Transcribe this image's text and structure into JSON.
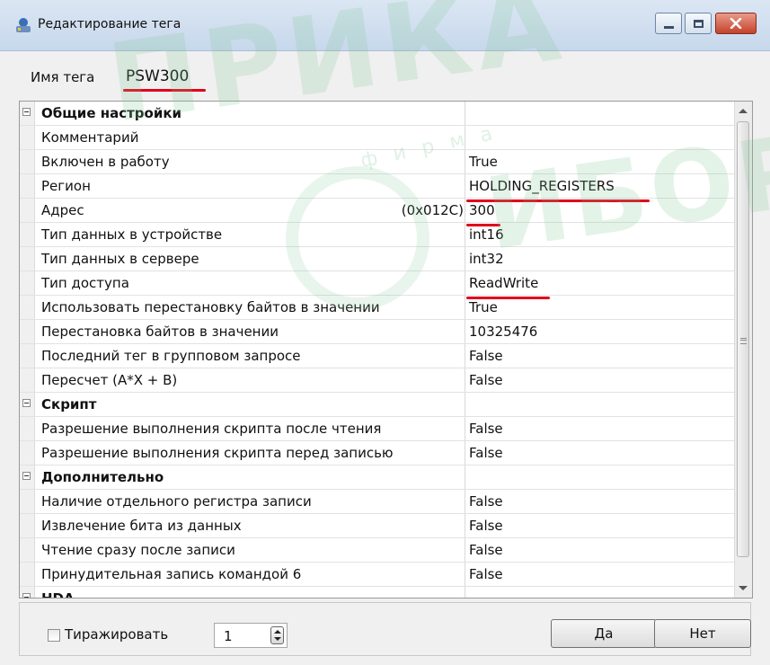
{
  "window": {
    "title": "Редактирование тега"
  },
  "tag": {
    "label": "Имя тега",
    "value": "PSW300"
  },
  "properties": [
    {
      "type": "category",
      "label": "Общие настройки"
    },
    {
      "type": "prop",
      "label": "Комментарий",
      "value": ""
    },
    {
      "type": "prop",
      "label": "Включен в работу",
      "value": "True"
    },
    {
      "type": "prop",
      "label": "Регион",
      "value": "HOLDING_REGISTERS"
    },
    {
      "type": "prop",
      "label": "Адрес",
      "hint": "(0x012C)",
      "value": "300"
    },
    {
      "type": "prop",
      "label": "Тип данных в устройстве",
      "value": "int16"
    },
    {
      "type": "prop",
      "label": "Тип данных в сервере",
      "value": "int32"
    },
    {
      "type": "prop",
      "label": "Тип доступа",
      "value": "ReadWrite"
    },
    {
      "type": "prop",
      "label": "Использовать перестановку байтов в значении",
      "value": "True"
    },
    {
      "type": "prop",
      "label": "Перестановка байтов в значении",
      "value": "10325476"
    },
    {
      "type": "prop",
      "label": "Последний тег в групповом запросе",
      "value": "False"
    },
    {
      "type": "prop",
      "label": "Пересчет (A*X + B)",
      "value": "False"
    },
    {
      "type": "category",
      "label": "Скрипт"
    },
    {
      "type": "prop",
      "label": "Разрешение выполнения скрипта после чтения",
      "value": "False"
    },
    {
      "type": "prop",
      "label": "Разрешение выполнения скрипта перед записью",
      "value": "False"
    },
    {
      "type": "category",
      "label": "Дополнительно"
    },
    {
      "type": "prop",
      "label": "Наличие отдельного регистра записи",
      "value": "False"
    },
    {
      "type": "prop",
      "label": "Извлечение бита из данных",
      "value": "False"
    },
    {
      "type": "prop",
      "label": "Чтение сразу после записи",
      "value": "False"
    },
    {
      "type": "prop",
      "label": "Принудительная запись командой 6",
      "value": "False"
    },
    {
      "type": "category",
      "label": "HDA"
    }
  ],
  "footer": {
    "replicate_label": "Тиражировать",
    "replicate_checked": false,
    "count_value": "1",
    "ok_label": "Да",
    "cancel_label": "Нет"
  },
  "watermark": {
    "big1": "ПРИКА",
    "big2": "ИБОР",
    "small": "фирма"
  },
  "colors": {
    "highlight_underline": "#e0001a"
  }
}
